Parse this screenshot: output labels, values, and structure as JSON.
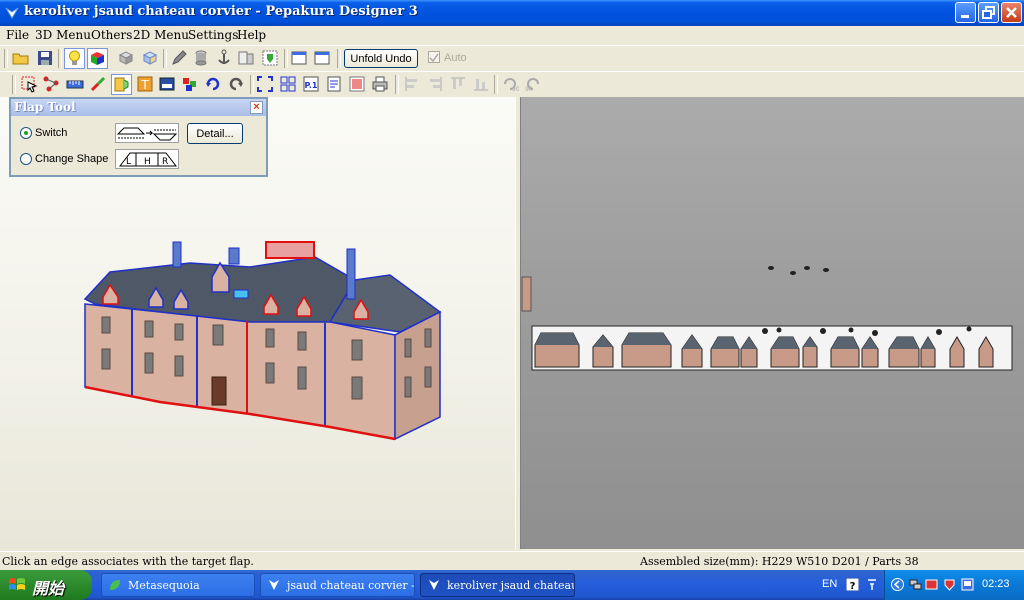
{
  "window": {
    "title": "keroliver jsaud chateau corvier - Pepakura Designer 3"
  },
  "menu": {
    "file": "File",
    "menu3d": "3D Menu",
    "others": "Others",
    "menu2d": "2D Menu",
    "settings": "Settings",
    "help": "Help"
  },
  "toolbar": {
    "unfold_undo": "Unfold Undo",
    "auto": "Auto",
    "auto_checked": true
  },
  "flap_tool": {
    "title": "Flap Tool",
    "switch_label": "Switch",
    "change_shape_label": "Change Shape",
    "detail_button": "Detail...",
    "selected": "Switch",
    "shape_letters": [
      "L",
      "H",
      "R"
    ]
  },
  "status": {
    "hint": "Click an edge associates with the target flap.",
    "assembled": "Assembled size(mm): H229  W510  D201 / Parts 38"
  },
  "taskbar": {
    "start": "開始",
    "items": [
      {
        "label": "Metasequoia",
        "active": false
      },
      {
        "label": "jsaud chateau corvier - ...",
        "active": false
      },
      {
        "label": "keroliver jsaud chateau...",
        "active": true
      }
    ],
    "language": "EN",
    "clock": "02:23"
  },
  "colors": {
    "title_blue": "#0053e0",
    "taskbar_blue": "#245edb",
    "start_green": "#2c8a2c",
    "view2d_gray": "#9e9e9e",
    "edge_blue": "#2030c8",
    "edge_red": "#e01010"
  }
}
